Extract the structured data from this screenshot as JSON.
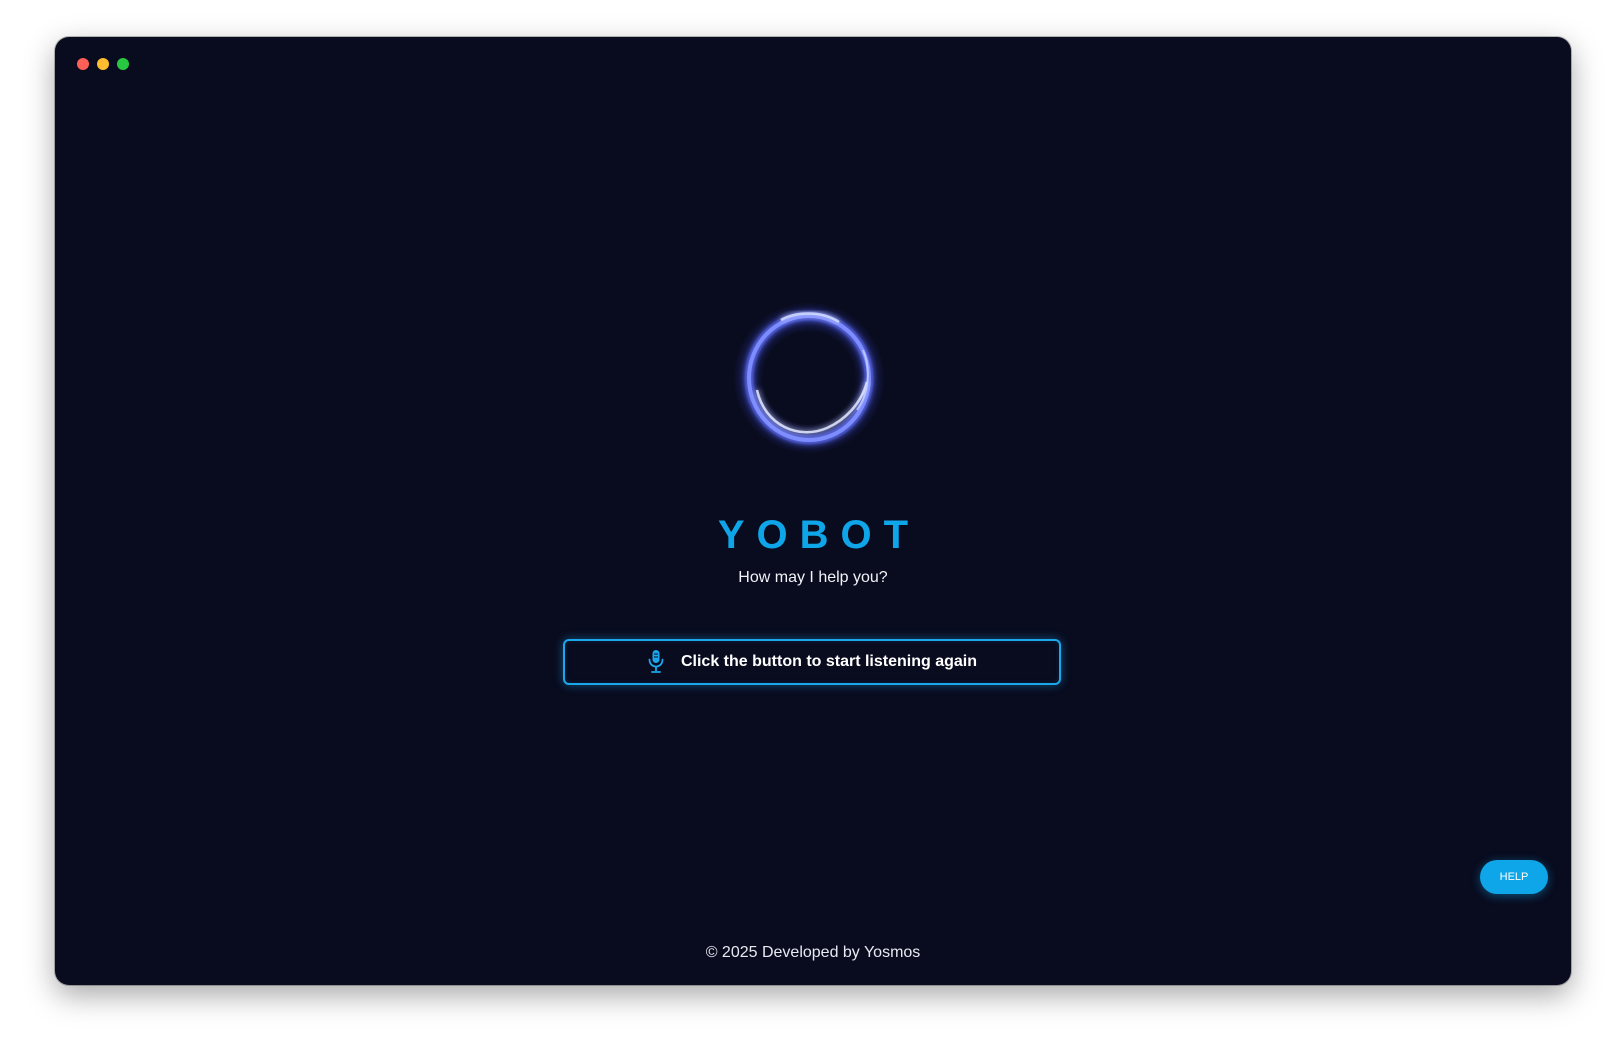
{
  "window": {
    "controls": [
      "close",
      "minimize",
      "maximize"
    ]
  },
  "hero": {
    "logo_icon": "glowing-ring-orb",
    "title": "YOBOT",
    "subtitle": "How may I help you?"
  },
  "listen_button": {
    "icon": "microphone-icon",
    "label": "Click the button to start listening again"
  },
  "help_button": {
    "label": "HELP"
  },
  "footer": {
    "text": "© 2025 Developed by Yosmos"
  },
  "colors": {
    "background": "#090b1e",
    "accent": "#0ea5e9",
    "text": "#ffffff"
  }
}
